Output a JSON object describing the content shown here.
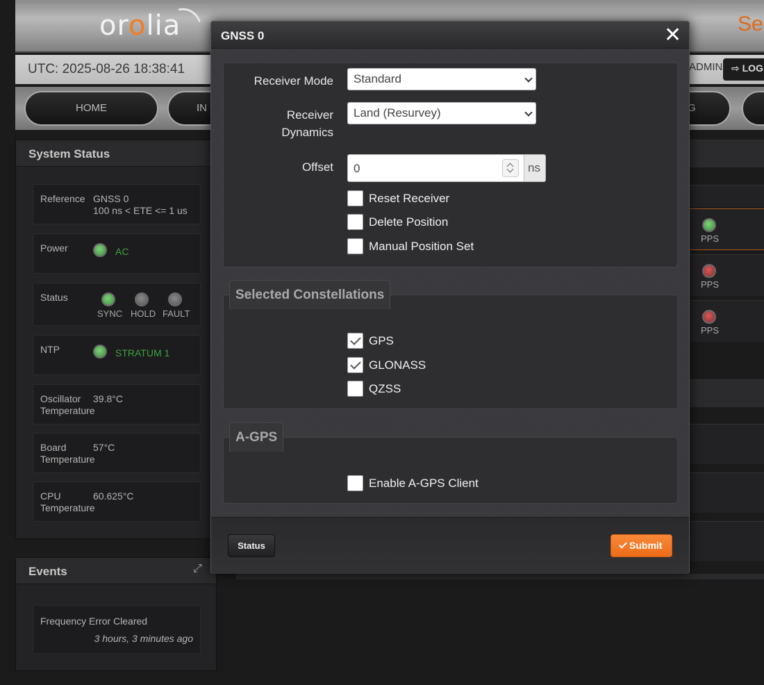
{
  "brand": {
    "logo_pre": "or",
    "logo_accent": "o",
    "logo_post": "lia"
  },
  "header": {
    "right_text": "Se"
  },
  "utc": {
    "text": "UTC: 2025-08-26 18:38:41"
  },
  "user": {
    "name": "ADMIN",
    "logout_label": "LOG"
  },
  "nav": {
    "items": [
      "HOME",
      "IN",
      "G"
    ]
  },
  "system_status": {
    "title": "System Status",
    "reference": {
      "label": "Reference",
      "value": "GNSS 0",
      "detail": "100 ns < ETE <= 1 us"
    },
    "power": {
      "label": "Power",
      "value": "AC"
    },
    "status": {
      "label": "Status",
      "leds": [
        "SYNC",
        "HOLD",
        "FAULT"
      ]
    },
    "ntp": {
      "label": "NTP",
      "value": "STRATUM 1"
    },
    "oscillator": {
      "label_1": "Oscillator",
      "label_2": "Temperature",
      "value": "39.8°C"
    },
    "board": {
      "label_1": "Board",
      "label_2": "Temperature",
      "value": "57°C"
    },
    "cpu": {
      "label_1": "CPU",
      "label_2": "Temperature",
      "value": "60.625°C"
    }
  },
  "right_strip": {
    "pps_labels": [
      "PPS",
      "PPS",
      "PPS"
    ]
  },
  "events": {
    "title": "Events",
    "items": [
      {
        "text": "Frequency Error Cleared",
        "time": "3 hours, 3 minutes ago"
      }
    ]
  },
  "modal": {
    "title": "GNSS 0",
    "close_glyph": "✕",
    "receiver_mode": {
      "label": "Receiver Mode",
      "value": "Standard"
    },
    "receiver_dynamics": {
      "label_1": "Receiver",
      "label_2": "Dynamics",
      "value": "Land (Resurvey)"
    },
    "offset": {
      "label": "Offset",
      "value": "0",
      "unit": "ns"
    },
    "options": [
      {
        "label": "Reset Receiver",
        "checked": false
      },
      {
        "label": "Delete Position",
        "checked": false
      },
      {
        "label": "Manual Position Set",
        "checked": false
      }
    ],
    "constellations": {
      "title": "Selected Constellations",
      "items": [
        {
          "label": "GPS",
          "checked": true
        },
        {
          "label": "GLONASS",
          "checked": true
        },
        {
          "label": "QZSS",
          "checked": false
        }
      ]
    },
    "agps": {
      "title": "A-GPS",
      "enable": {
        "label": "Enable A-GPS Client",
        "checked": false
      }
    },
    "footer": {
      "status_label": "Status",
      "submit_label": "Submit"
    }
  },
  "colors": {
    "accent": "#f47c20",
    "ok": "#3fa23c",
    "alarm": "#b83a3a"
  }
}
